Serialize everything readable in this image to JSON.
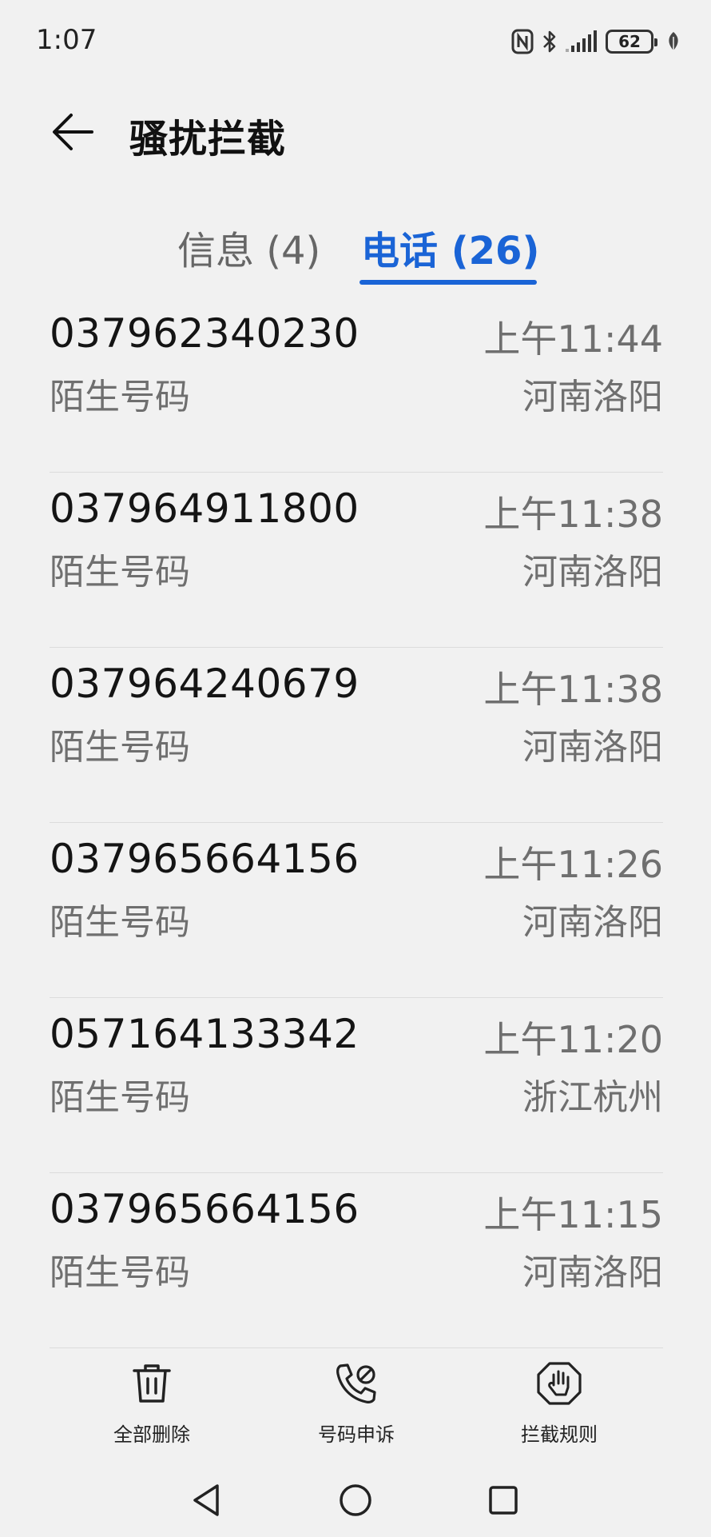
{
  "status_bar": {
    "time": "1:07",
    "battery_level": "62",
    "icons": [
      "nfc-icon",
      "bluetooth-icon",
      "signal-icon",
      "battery-icon",
      "leaf-icon"
    ]
  },
  "header": {
    "title": "骚扰拦截"
  },
  "tabs": {
    "messages_label": "信息 (4)",
    "calls_label": "电话 (26)",
    "active": "calls"
  },
  "calls": [
    {
      "number": "037962340230",
      "label": "陌生号码",
      "time": "上午11:44",
      "location": "河南洛阳"
    },
    {
      "number": "037964911800",
      "label": "陌生号码",
      "time": "上午11:38",
      "location": "河南洛阳"
    },
    {
      "number": "037964240679",
      "label": "陌生号码",
      "time": "上午11:38",
      "location": "河南洛阳"
    },
    {
      "number": "037965664156",
      "label": "陌生号码",
      "time": "上午11:26",
      "location": "河南洛阳"
    },
    {
      "number": "057164133342",
      "label": "陌生号码",
      "time": "上午11:20",
      "location": "浙江杭州"
    },
    {
      "number": "037965664156",
      "label": "陌生号码",
      "time": "上午11:15",
      "location": "河南洛阳"
    }
  ],
  "toolbar": {
    "delete_all_label": "全部删除",
    "appeal_label": "号码申诉",
    "rules_label": "拦截规则"
  },
  "colors": {
    "accent": "#1a64d6",
    "background": "#f1f1f1",
    "secondary_text": "#6f6f6f"
  }
}
